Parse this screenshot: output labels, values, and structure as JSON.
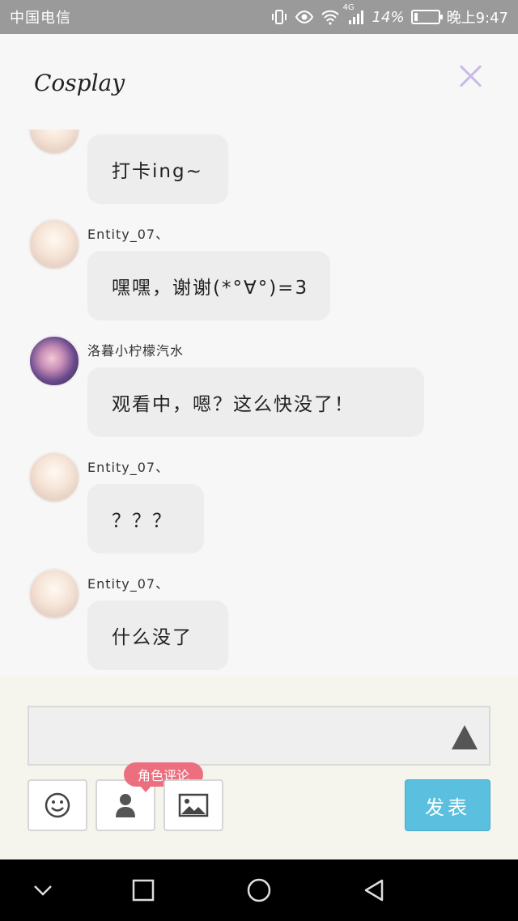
{
  "status_bar": {
    "carrier": "中国电信",
    "battery_percent": "14%",
    "time": "晚上9:47",
    "signal_label": "4G",
    "battery_level": 0.14
  },
  "header": {
    "title": "Cosplay"
  },
  "messages": [
    {
      "user": "",
      "text": "打卡ing~",
      "avatar": "light"
    },
    {
      "user": "Entity_07、",
      "text": "嘿嘿，谢谢(*°∀°)=3",
      "avatar": "light"
    },
    {
      "user": "洛暮小柠檬汽水",
      "text": "观看中，嗯？这么快没了！",
      "avatar": "dark"
    },
    {
      "user": "Entity_07、",
      "text": "？？？",
      "avatar": "light"
    },
    {
      "user": "Entity_07、",
      "text": "什么没了",
      "avatar": "light"
    }
  ],
  "composer": {
    "input_value": "",
    "role_tag": "角色评论",
    "publish_label": "发表"
  },
  "colors": {
    "accent": "#5bbfe0",
    "tag": "#ec6f7f",
    "close": "#c9b9e8"
  }
}
